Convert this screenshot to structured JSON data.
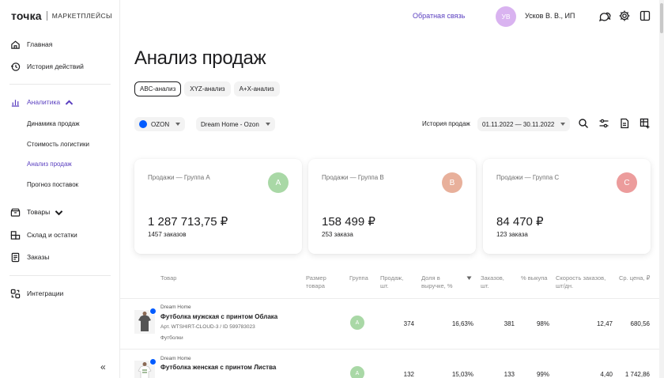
{
  "logo": {
    "main": "точка",
    "sub": "МАРКЕТПЛЕЙСЫ"
  },
  "sidebar": {
    "items": [
      {
        "label": "Главная",
        "icon": "home-icon"
      },
      {
        "label": "История действий",
        "icon": "history-icon"
      },
      {
        "label": "Аналитика",
        "icon": "chart-icon",
        "expanded": true
      },
      {
        "label": "Товары",
        "icon": "goods-icon"
      },
      {
        "label": "Склад и остатки",
        "icon": "warehouse-icon"
      },
      {
        "label": "Заказы",
        "icon": "orders-icon"
      },
      {
        "label": "Интеграции",
        "icon": "integrations-icon"
      }
    ],
    "analytics_sub": [
      "Динамика продаж",
      "Стоимость логистики",
      "Анализ продаж",
      "Прогноз поставок"
    ],
    "collapse_label": "«"
  },
  "header": {
    "feedback": "Обратная связь",
    "avatar_initials": "УВ",
    "user_name": "Усков В. В., ИП",
    "accent": "#5a3fc0"
  },
  "main": {
    "title": "Анализ продаж",
    "tabs": [
      "ABC-анализ",
      "XYZ-анализ",
      "A+X-анализ"
    ],
    "active_tab": "ABC-анализ",
    "filters": {
      "marketplace": "OZON",
      "store": "Dream Home - Ozon",
      "history_label": "История продаж",
      "date_range": "01.11.2022 — 30.11.2022"
    },
    "cards": [
      {
        "label": "Продажи — Группа А",
        "badge": "A",
        "value": "1 287 713,75 ₽",
        "orders": "1457 заказов",
        "color": "#a9d8a6"
      },
      {
        "label": "Продажи — Группа B",
        "badge": "B",
        "value": "158 499 ₽",
        "orders": "253 заказа",
        "color": "#e8b09b"
      },
      {
        "label": "Продажи — Группа С",
        "badge": "C",
        "value": "84 470 ₽",
        "orders": "123 заказа",
        "color": "#ec9c9c"
      }
    ],
    "table": {
      "headers": [
        "Товар",
        "Размер товара",
        "Группа",
        "Продаж, шт.",
        "Доля в выручке, %",
        "Заказов, шт.",
        "% выкупа",
        "Скорость заказов, шт/дн.",
        "Ср. цена, ₽"
      ],
      "rows": [
        {
          "brand": "Dream Home",
          "name": "Футболка мужская с принтом Облака",
          "sku": "Арт. WTSHIRT-CLOUD-3 / ID 599783023",
          "category": "Футболки",
          "group": "A",
          "sales": "374",
          "share": "16,63%",
          "orders": "381",
          "buyout": "98%",
          "speed": "12,47",
          "price": "680,56"
        },
        {
          "brand": "Dream Home",
          "name": "Футболка женская с принтом Листва",
          "sku": "",
          "category": "",
          "group": "A",
          "sales": "132",
          "share": "15,03%",
          "orders": "133",
          "buyout": "99%",
          "speed": "4,40",
          "price": "1 742,86"
        }
      ]
    }
  }
}
